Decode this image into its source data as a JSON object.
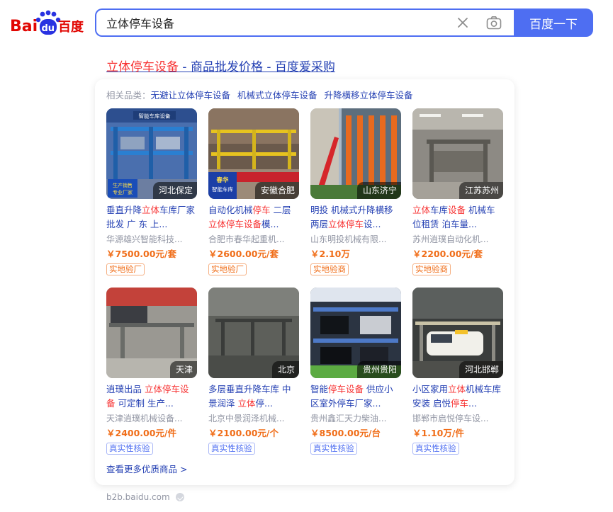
{
  "header": {
    "logo_text_left": "Bai",
    "logo_text_paw": "du",
    "logo_text_right": "百度",
    "search_value": "立体停车设备",
    "search_button": "百度一下"
  },
  "result": {
    "title_highlight": "立体停车设备",
    "title_rest": " - 商品批发价格 - 百度爱采购",
    "related_label": "相关品类：",
    "related": [
      "无避让立体停车设备",
      "机械式立体停车设备",
      "升降横移立体停车设备"
    ],
    "more": "查看更多优质商品 >",
    "domain": "b2b.baidu.com"
  },
  "products": [
    {
      "location": "河北保定",
      "name_html": "垂直升降<em>立体</em>车库厂家批发 广 东 上...",
      "seller": "华源雄兴智能科技...",
      "price": "￥7500.00元/套",
      "badge": "实地验厂",
      "badge_type": "orange",
      "overlay_texts": [
        "智能车库设备",
        "生产销售",
        "专业厂家"
      ]
    },
    {
      "location": "安徽合肥",
      "name_html": "自动化机械<em>停车</em> 二层<em>立体停车设备</em>模...",
      "seller": "合肥市春华起重机...",
      "price": "￥2600.00元/套",
      "badge": "实地验厂",
      "badge_type": "orange",
      "overlay_texts": [
        "春华",
        "智能车库"
      ]
    },
    {
      "location": "山东济宁",
      "name_html": "明投 机械式升降横移两层<em>立体停车</em>设...",
      "seller": "山东明投机械有限...",
      "price": "￥2.10万",
      "badge": "实地验商",
      "badge_type": "orange",
      "overlay_texts": []
    },
    {
      "location": "江苏苏州",
      "name_html": "<em>立体</em>车库<em>设备</em> 机械车位租赁 泊车量...",
      "seller": "苏州逍璞自动化机...",
      "price": "￥2200.00元/套",
      "badge": "实地验商",
      "badge_type": "orange",
      "overlay_texts": []
    },
    {
      "location": "天津",
      "name_html": "逍璞出品 <em>立体停车设备</em> 可定制 生产...",
      "seller": "天津逍璞机械设备...",
      "price": "￥2400.00元/件",
      "badge": "真实性核验",
      "badge_type": "blue",
      "overlay_texts": []
    },
    {
      "location": "北京",
      "name_html": "多层垂直升降车库 中景润泽 <em>立体</em>停...",
      "seller": "北京中景润泽机械...",
      "price": "￥2100.00元/个",
      "badge": "真实性核验",
      "badge_type": "blue",
      "overlay_texts": []
    },
    {
      "location": "贵州贵阳",
      "name_html": "智能<em>停车设备</em> 供应小区室外停车厂家...",
      "seller": "贵州鑫汇天力柴油...",
      "price": "￥8500.00元/台",
      "badge": "真实性核验",
      "badge_type": "blue",
      "overlay_texts": []
    },
    {
      "location": "河北邯郸",
      "name_html": "小区家用<em>立体</em>机械车库安装 启悦<em>停车</em>...",
      "seller": "邯郸市启悦停车设...",
      "price": "￥1.10万/件",
      "badge": "真实性核验",
      "badge_type": "blue",
      "overlay_texts": []
    }
  ],
  "colors": {
    "brand_blue": "#4e6ef2",
    "link": "#2440b3",
    "highlight": "#f73131",
    "price": "#f06d18"
  }
}
